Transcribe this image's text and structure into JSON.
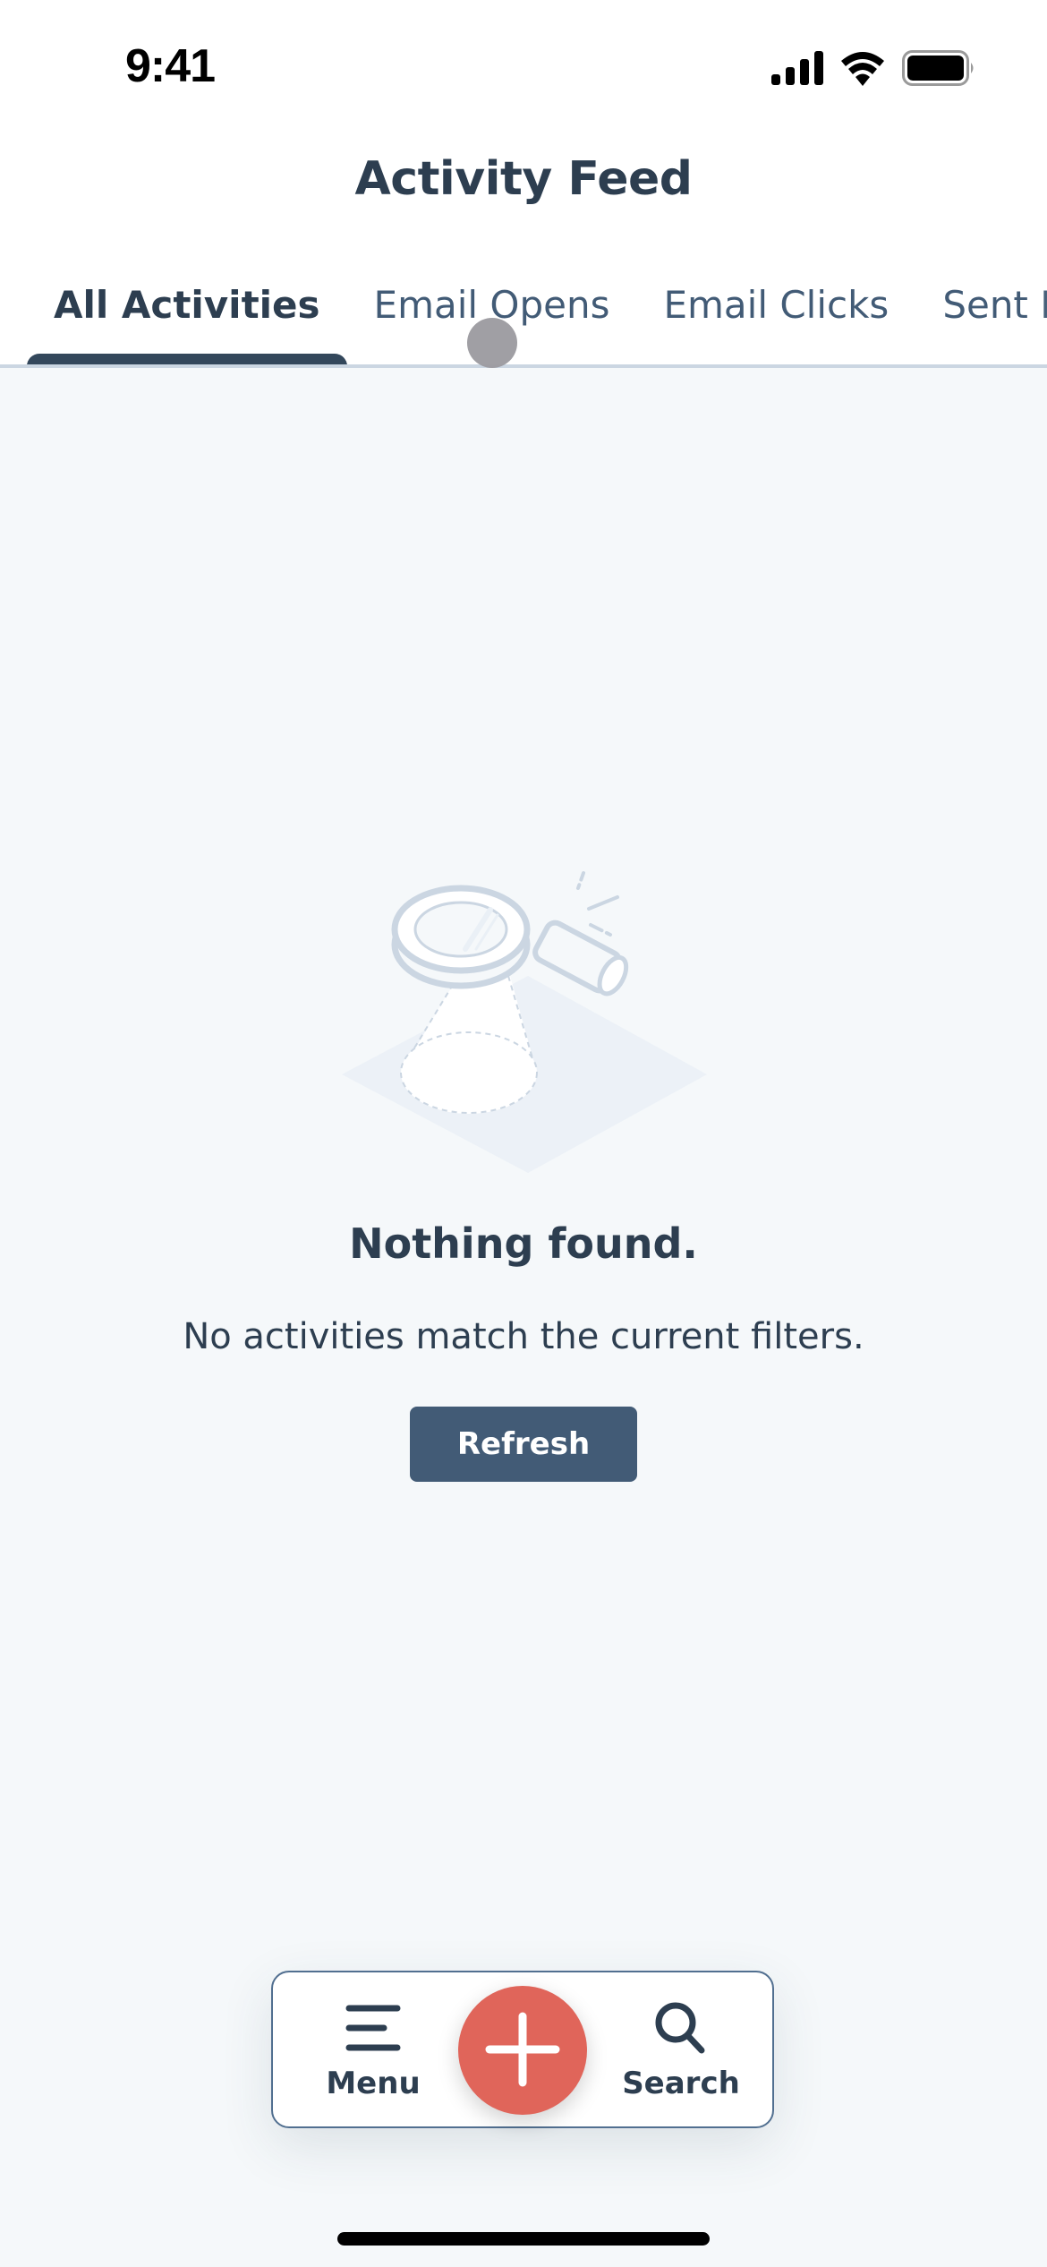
{
  "status_bar": {
    "time": "9:41",
    "icons": [
      "cellular-signal-icon",
      "wifi-icon",
      "battery-icon"
    ]
  },
  "header": {
    "title": "Activity Feed"
  },
  "tabs": [
    {
      "label": "All Activities",
      "active": true
    },
    {
      "label": "Email Opens",
      "active": false
    },
    {
      "label": "Email Clicks",
      "active": false
    },
    {
      "label": "Sent Em",
      "active": false
    }
  ],
  "empty_state": {
    "illustration": "magnifying-glass-spotlight-illustration",
    "title": "Nothing found.",
    "description": "No activities match the current filters.",
    "button_label": "Refresh"
  },
  "bottom_nav": {
    "menu_label": "Menu",
    "menu_icon": "hamburger-menu-icon",
    "add_icon": "plus-icon",
    "search_label": "Search",
    "search_icon": "search-icon"
  },
  "colors": {
    "primary_text": "#2d3e50",
    "secondary_text": "#425b76",
    "button_bg": "#425b76",
    "fab_accent": "#e0655a",
    "background": "#f5f8fa",
    "tab_underline": "#33475b"
  }
}
